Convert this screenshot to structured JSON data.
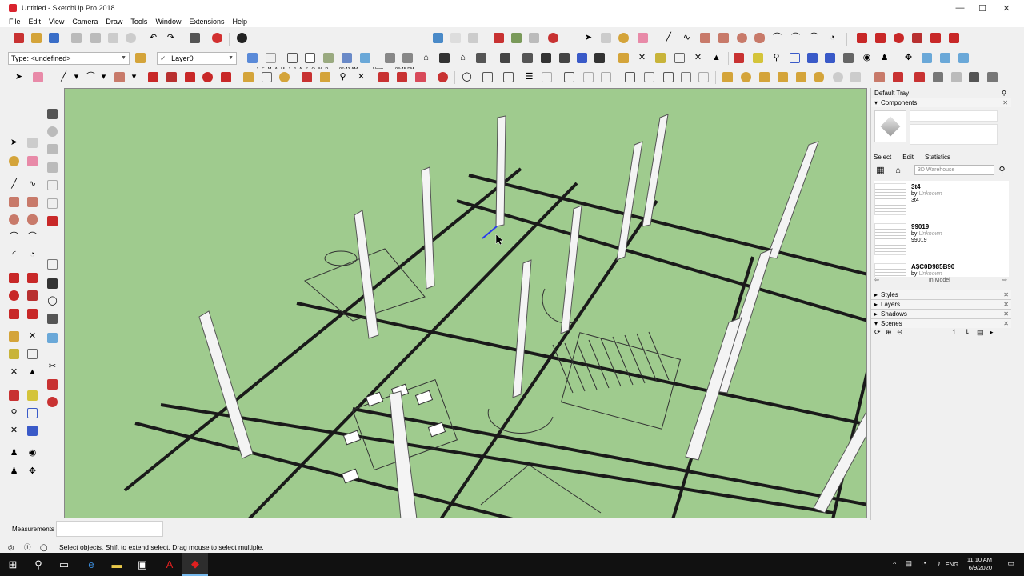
{
  "window": {
    "title": "Untitled - SketchUp Pro 2018",
    "minimize": "—",
    "maximize": "☐",
    "close": "✕"
  },
  "menu": [
    "File",
    "Edit",
    "View",
    "Camera",
    "Draw",
    "Tools",
    "Window",
    "Extensions",
    "Help"
  ],
  "toolbar": {
    "type_select": "Type: <undefined>",
    "layer_select": "Layer0",
    "layer_check": "✓",
    "shadow_months": "J F M A M J J A S O N D",
    "time_start": "06:43 AM",
    "time_noon": "Noon",
    "time_end": "04:45 PM"
  },
  "tray": {
    "title": "Default Tray",
    "components_header": "Components",
    "tabs": [
      "Select",
      "Edit",
      "Statistics"
    ],
    "search_placeholder": "3D Warehouse",
    "items": [
      {
        "title": "3t4",
        "by": "by",
        "author": "Unknown",
        "sub": "3t4"
      },
      {
        "title": "99019",
        "by": "by",
        "author": "Unknown",
        "sub": "99019"
      },
      {
        "title": "A$C0D985B90",
        "by": "by",
        "author": "Unknown",
        "sub": ""
      }
    ],
    "in_model": "In Model",
    "sections": [
      "Styles",
      "Layers",
      "Shadows",
      "Scenes"
    ]
  },
  "measurements": {
    "label": "Measurements",
    "value": ""
  },
  "status": {
    "text": "Select objects. Shift to extend select. Drag mouse to select multiple."
  },
  "taskbar": {
    "lang": "ENG",
    "time": "11:10 AM",
    "date": "6/9/2020"
  },
  "colors": {
    "viewport_bg": "#9fcb8e",
    "sketchup_red": "#d9232e",
    "taskbar_bg": "#111111"
  }
}
